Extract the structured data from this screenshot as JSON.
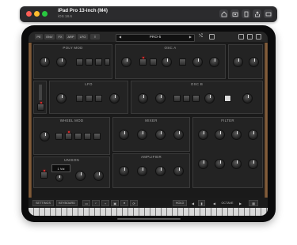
{
  "window": {
    "title": "iPad Pro 13-inch (M4)",
    "subtitle": "iOS 18.6",
    "toolbar_icons": [
      "home-icon",
      "screenshot-icon",
      "rotate-icon",
      "share-icon",
      "keyboard-icon"
    ]
  },
  "app": {
    "tabs": [
      "PE",
      "ENV",
      "FX",
      "ARP",
      "LFO"
    ],
    "preset_name": "PRO-5",
    "top_icons": [
      "random-icon",
      "save-icon",
      "help-icon",
      "settings-icon",
      "menu-icon"
    ],
    "sections": {
      "poly_mod": "POLY MOD",
      "osc_a": "OSC A",
      "lfo": "LFO",
      "osc_b": "OSC B",
      "wheel_mod": "WHEEL MOD",
      "mixer": "MIXER",
      "filter": "FILTER",
      "unison": "UNISON",
      "amplifier": "AMPLIFIER"
    },
    "unison_display": "1 Voi",
    "bottom": {
      "settings": "SETTINGS",
      "keyboard": "KEYBOARD",
      "hold": "HOLD",
      "octave": "OCTAVE"
    }
  },
  "colors": {
    "accent_led": "#ff2a2a",
    "wood": "#8a6440",
    "panel": "#232323"
  }
}
